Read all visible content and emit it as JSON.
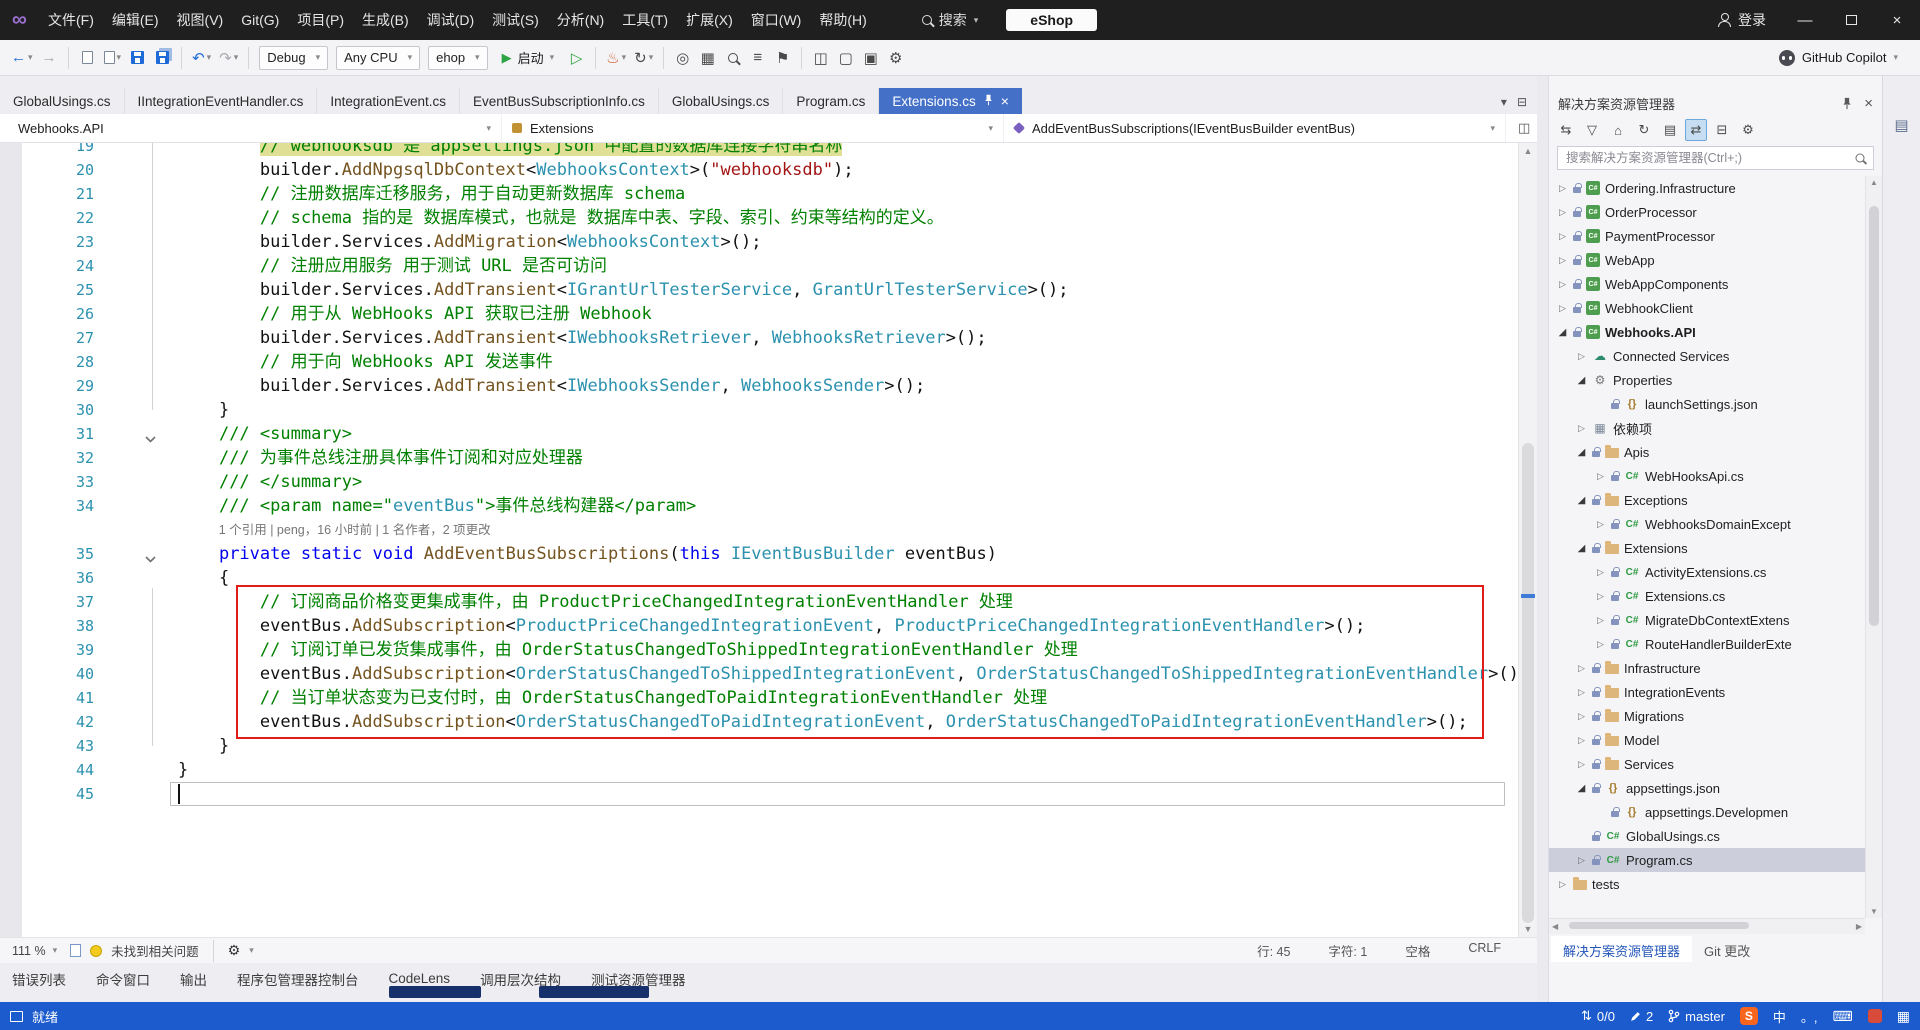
{
  "colors": {
    "accent": "#4470C8",
    "statusbar": "#1C5BCE",
    "annotation": "#E21B1B",
    "selection": "#CCCEDB",
    "comment": "#008000",
    "keyword": "#0000F0",
    "type": "#2B91AF",
    "string": "#A31515",
    "method": "#74531F",
    "sogou": "#F7641E"
  },
  "icons": {
    "back": "←",
    "forward": "→",
    "undo": "↶",
    "redo": "↷",
    "play_outline": "▷",
    "hot_reload": "♨",
    "restart": "↻",
    "caret": "▾",
    "wrench": "⚙",
    "attach": "◎",
    "query": "▦",
    "lines": "≡",
    "bookmark": "⚑",
    "splitview": "◫",
    "window": "▢",
    "preview": "▣",
    "options": "⚙",
    "tab_list": "▾",
    "tab_extra": "⊟",
    "split_editor": "◫",
    "minimize": "—",
    "close": "×",
    "updown": "⇅",
    "keyboard": "⌨",
    "grid": "▦",
    "se_switch": "⇆",
    "se_filter": "▽",
    "se_home": "⌂",
    "se_refresh": "↻",
    "se_nest": "▤",
    "se_sync": "⇄",
    "se_collapse": "⊟",
    "se_props": "⚙",
    "chev_collapsed": "▷",
    "chev_expanded": "◢",
    "strip": "▤",
    "scroll_up": "▲",
    "scroll_down": "▼",
    "scroll_left": "◀",
    "scroll_right": "▶",
    "tree_glyphs": {
      "project": "C#",
      "cs": "C#",
      "json": "{}",
      "props": "⚙",
      "refs": "▦",
      "conn": "☁"
    }
  },
  "window": {
    "menu": [
      "文件(F)",
      "编辑(E)",
      "视图(V)",
      "Git(G)",
      "项目(P)",
      "生成(B)",
      "调试(D)",
      "测试(S)",
      "分析(N)",
      "工具(T)",
      "扩展(X)",
      "窗口(W)",
      "帮助(H)"
    ],
    "search_label": "搜索",
    "solution_name": "eShop",
    "signin_label": "登录"
  },
  "toolbar": {
    "debug_config": "Debug",
    "platform": "Any CPU",
    "startup_project": "ehop",
    "start_label": "启动",
    "copilot_label": "GitHub Copilot"
  },
  "tabs": [
    {
      "label": "GlobalUsings.cs"
    },
    {
      "label": "IIntegrationEventHandler.cs"
    },
    {
      "label": "IntegrationEvent.cs"
    },
    {
      "label": "EventBusSubscriptionInfo.cs"
    },
    {
      "label": "GlobalUsings.cs"
    },
    {
      "label": "Program.cs"
    },
    {
      "label": "Extensions.cs",
      "active": true
    }
  ],
  "breadcrumb": [
    {
      "label": "Webhooks.API",
      "icon": "csharp-file-icon"
    },
    {
      "label": "Extensions",
      "icon": "class-icon"
    },
    {
      "label": "AddEventBusSubscriptions(IEventBusBuilder eventBus)",
      "icon": "method-icon"
    }
  ],
  "editor": {
    "annotation": {
      "from_line": 37,
      "to_line": 42
    },
    "rows": [
      {
        "n": 19,
        "ind": 8,
        "mark": true,
        "seg": [
          [
            "c",
            "// webhooksdb 是 appsettings.json 中配置的数据库连接字符串名称"
          ]
        ]
      },
      {
        "n": 20,
        "ind": 8,
        "seg": [
          [
            "p",
            "builder."
          ],
          [
            "m",
            "AddNpgsqlDbContext"
          ],
          [
            "p",
            "<"
          ],
          [
            "t",
            "WebhooksContext"
          ],
          [
            "p",
            ">("
          ],
          [
            "s",
            "\"webhooksdb\""
          ],
          [
            "p",
            ");"
          ]
        ]
      },
      {
        "n": 21,
        "ind": 8,
        "seg": [
          [
            "c",
            "// 注册数据库迁移服务，用于自动更新数据库 schema"
          ]
        ]
      },
      {
        "n": 22,
        "ind": 8,
        "seg": [
          [
            "c",
            "// schema 指的是 数据库模式，也就是 数据库中表、字段、索引、约束等结构的定义。"
          ]
        ]
      },
      {
        "n": 23,
        "ind": 8,
        "seg": [
          [
            "p",
            "builder.Services."
          ],
          [
            "m",
            "AddMigration"
          ],
          [
            "p",
            "<"
          ],
          [
            "t",
            "WebhooksContext"
          ],
          [
            "p",
            ">();"
          ]
        ]
      },
      {
        "n": 24,
        "ind": 8,
        "seg": [
          [
            "c",
            "// 注册应用服务 用于测试 URL 是否可访问"
          ]
        ]
      },
      {
        "n": 25,
        "ind": 8,
        "seg": [
          [
            "p",
            "builder.Services."
          ],
          [
            "m",
            "AddTransient"
          ],
          [
            "p",
            "<"
          ],
          [
            "t",
            "IGrantUrlTesterService"
          ],
          [
            "p",
            ", "
          ],
          [
            "t",
            "GrantUrlTesterService"
          ],
          [
            "p",
            ">();"
          ]
        ]
      },
      {
        "n": 26,
        "ind": 8,
        "seg": [
          [
            "c",
            "// 用于从 WebHooks API 获取已注册 Webhook"
          ]
        ]
      },
      {
        "n": 27,
        "ind": 8,
        "seg": [
          [
            "p",
            "builder.Services."
          ],
          [
            "m",
            "AddTransient"
          ],
          [
            "p",
            "<"
          ],
          [
            "t",
            "IWebhooksRetriever"
          ],
          [
            "p",
            ", "
          ],
          [
            "t",
            "WebhooksRetriever"
          ],
          [
            "p",
            ">();"
          ]
        ]
      },
      {
        "n": 28,
        "ind": 8,
        "seg": [
          [
            "c",
            "// 用于向 WebHooks API 发送事件"
          ]
        ]
      },
      {
        "n": 29,
        "ind": 8,
        "seg": [
          [
            "p",
            "builder.Services."
          ],
          [
            "m",
            "AddTransient"
          ],
          [
            "p",
            "<"
          ],
          [
            "t",
            "IWebhooksSender"
          ],
          [
            "p",
            ", "
          ],
          [
            "t",
            "WebhooksSender"
          ],
          [
            "p",
            ">();"
          ]
        ]
      },
      {
        "n": 30,
        "ind": 4,
        "seg": [
          [
            "p",
            "}"
          ]
        ]
      },
      {
        "n": 31,
        "ind": 4,
        "fold": true,
        "seg": [
          [
            "c",
            "/// <summary>"
          ]
        ]
      },
      {
        "n": 32,
        "ind": 4,
        "seg": [
          [
            "c",
            "/// 为事件总线注册具体事件订阅和对应处理器"
          ]
        ]
      },
      {
        "n": 33,
        "ind": 4,
        "seg": [
          [
            "c",
            "/// </summary>"
          ]
        ]
      },
      {
        "n": 34,
        "ind": 4,
        "seg": [
          [
            "c",
            "/// <param name=\""
          ],
          [
            "t",
            "eventBus"
          ],
          [
            "c",
            "\">事件总线构建器</param>"
          ]
        ]
      },
      {
        "lens": true,
        "ind": 4,
        "text": "1 个引用 | peng，16 小时前 | 1 名作者，2 项更改"
      },
      {
        "n": 35,
        "ind": 4,
        "fold": true,
        "seg": [
          [
            "k",
            "private"
          ],
          [
            "p",
            " "
          ],
          [
            "k",
            "static"
          ],
          [
            "p",
            " "
          ],
          [
            "k",
            "void"
          ],
          [
            "p",
            " "
          ],
          [
            "m",
            "AddEventBusSubscriptions"
          ],
          [
            "p",
            "("
          ],
          [
            "k",
            "this"
          ],
          [
            "p",
            " "
          ],
          [
            "t",
            "IEventBusBuilder"
          ],
          [
            "p",
            " eventBus)"
          ]
        ]
      },
      {
        "n": 36,
        "ind": 4,
        "seg": [
          [
            "p",
            "{"
          ]
        ]
      },
      {
        "n": 37,
        "ind": 8,
        "seg": [
          [
            "c",
            "// 订阅商品价格变更集成事件，由 ProductPriceChangedIntegrationEventHandler 处理"
          ]
        ]
      },
      {
        "n": 38,
        "ind": 8,
        "seg": [
          [
            "p",
            "eventBus."
          ],
          [
            "m",
            "AddSubscription"
          ],
          [
            "p",
            "<"
          ],
          [
            "t",
            "ProductPriceChangedIntegrationEvent"
          ],
          [
            "p",
            ", "
          ],
          [
            "t",
            "ProductPriceChangedIntegrationEventHandler"
          ],
          [
            "p",
            ">();"
          ]
        ]
      },
      {
        "n": 39,
        "ind": 8,
        "seg": [
          [
            "c",
            "// 订阅订单已发货集成事件，由 OrderStatusChangedToShippedIntegrationEventHandler 处理"
          ]
        ]
      },
      {
        "n": 40,
        "ind": 8,
        "seg": [
          [
            "p",
            "eventBus."
          ],
          [
            "m",
            "AddSubscription"
          ],
          [
            "p",
            "<"
          ],
          [
            "t",
            "OrderStatusChangedToShippedIntegrationEvent"
          ],
          [
            "p",
            ", "
          ],
          [
            "t",
            "OrderStatusChangedToShippedIntegrationEventHandler"
          ],
          [
            "p",
            ">();"
          ]
        ]
      },
      {
        "n": 41,
        "ind": 8,
        "seg": [
          [
            "c",
            "// 当订单状态变为已支付时，由 OrderStatusChangedToPaidIntegrationEventHandler 处理"
          ]
        ]
      },
      {
        "n": 42,
        "ind": 8,
        "seg": [
          [
            "p",
            "eventBus."
          ],
          [
            "m",
            "AddSubscription"
          ],
          [
            "p",
            "<"
          ],
          [
            "t",
            "OrderStatusChangedToPaidIntegrationEvent"
          ],
          [
            "p",
            ", "
          ],
          [
            "t",
            "OrderStatusChangedToPaidIntegrationEventHandler"
          ],
          [
            "p",
            ">();"
          ]
        ]
      },
      {
        "n": 43,
        "ind": 4,
        "seg": [
          [
            "p",
            "}"
          ]
        ]
      },
      {
        "n": 44,
        "ind": 0,
        "seg": [
          [
            "p",
            "}"
          ]
        ]
      },
      {
        "n": 45,
        "ind": 0,
        "current": true,
        "caret": true,
        "seg": []
      }
    ]
  },
  "editor_status": {
    "zoom": "111 %",
    "issues": "未找到相关问题",
    "line": "行: 45",
    "col": "字符: 1",
    "space": "空格",
    "eol": "CRLF"
  },
  "panel_tabs": [
    "错误列表",
    "命令窗口",
    "输出",
    "程序包管理器控制台",
    "CodeLens",
    "调用层次结构",
    "测试资源管理器"
  ],
  "solution_explorer": {
    "title": "解决方案资源管理器",
    "search_placeholder": "搜索解决方案资源管理器(Ctrl+;)",
    "tabs": [
      {
        "label": "解决方案资源管理器",
        "active": true
      },
      {
        "label": "Git 更改"
      }
    ],
    "tree": [
      {
        "label": "Ordering.Infrastructure",
        "lvl": 0,
        "icon": "project",
        "chev": "r",
        "lock": true
      },
      {
        "label": "OrderProcessor",
        "lvl": 0,
        "icon": "project",
        "chev": "r",
        "lock": true
      },
      {
        "label": "PaymentProcessor",
        "lvl": 0,
        "icon": "project",
        "chev": "r",
        "lock": true
      },
      {
        "label": "WebApp",
        "lvl": 0,
        "icon": "project",
        "chev": "r",
        "lock": true
      },
      {
        "label": "WebAppComponents",
        "lvl": 0,
        "icon": "project",
        "chev": "r",
        "lock": true
      },
      {
        "label": "WebhookClient",
        "lvl": 0,
        "icon": "project",
        "chev": "r",
        "lock": true
      },
      {
        "label": "Webhooks.API",
        "lvl": 0,
        "icon": "project",
        "chev": "d",
        "lock": true,
        "bold": true
      },
      {
        "label": "Connected Services",
        "lvl": 1,
        "icon": "conn",
        "chev": "r"
      },
      {
        "label": "Properties",
        "lvl": 1,
        "icon": "props",
        "chev": "d"
      },
      {
        "label": "launchSettings.json",
        "lvl": 2,
        "icon": "json",
        "lock": true
      },
      {
        "label": "依赖项",
        "lvl": 1,
        "icon": "refs",
        "chev": "r"
      },
      {
        "label": "Apis",
        "lvl": 1,
        "icon": "folder",
        "chev": "d",
        "lock": true
      },
      {
        "label": "WebHooksApi.cs",
        "lvl": 2,
        "icon": "cs",
        "chev": "r",
        "lock": true
      },
      {
        "label": "Exceptions",
        "lvl": 1,
        "icon": "folder",
        "chev": "d",
        "lock": true
      },
      {
        "label": "WebhooksDomainExcept",
        "lvl": 2,
        "icon": "cs",
        "chev": "r",
        "lock": true
      },
      {
        "label": "Extensions",
        "lvl": 1,
        "icon": "folder",
        "chev": "d",
        "lock": true
      },
      {
        "label": "ActivityExtensions.cs",
        "lvl": 2,
        "icon": "cs",
        "chev": "r",
        "lock": true
      },
      {
        "label": "Extensions.cs",
        "lvl": 2,
        "icon": "cs",
        "chev": "r",
        "lock": true
      },
      {
        "label": "MigrateDbContextExtens",
        "lvl": 2,
        "icon": "cs",
        "chev": "r",
        "lock": true
      },
      {
        "label": "RouteHandlerBuilderExte",
        "lvl": 2,
        "icon": "cs",
        "chev": "r",
        "lock": true
      },
      {
        "label": "Infrastructure",
        "lvl": 1,
        "icon": "folder",
        "chev": "r",
        "lock": true
      },
      {
        "label": "IntegrationEvents",
        "lvl": 1,
        "icon": "folder",
        "chev": "r",
        "lock": true
      },
      {
        "label": "Migrations",
        "lvl": 1,
        "icon": "folder",
        "chev": "r",
        "lock": true
      },
      {
        "label": "Model",
        "lvl": 1,
        "icon": "folder",
        "chev": "r",
        "lock": true
      },
      {
        "label": "Services",
        "lvl": 1,
        "icon": "folder",
        "chev": "r",
        "lock": true
      },
      {
        "label": "appsettings.json",
        "lvl": 1,
        "icon": "json",
        "chev": "d",
        "lock": true
      },
      {
        "label": "appsettings.Developmen",
        "lvl": 2,
        "icon": "json",
        "lock": true
      },
      {
        "label": "GlobalUsings.cs",
        "lvl": 1,
        "icon": "cs",
        "lock": true
      },
      {
        "label": "Program.cs",
        "lvl": 1,
        "icon": "cs",
        "chev": "r",
        "lock": true,
        "selected": true
      },
      {
        "label": "tests",
        "lvl": 0,
        "icon": "folder",
        "chev": "r"
      }
    ]
  },
  "statusbar": {
    "ready": "就绪",
    "sync": "0/0",
    "edits": "2",
    "branch": "master",
    "ime_lang": "中",
    "ime_punct": "。,"
  }
}
